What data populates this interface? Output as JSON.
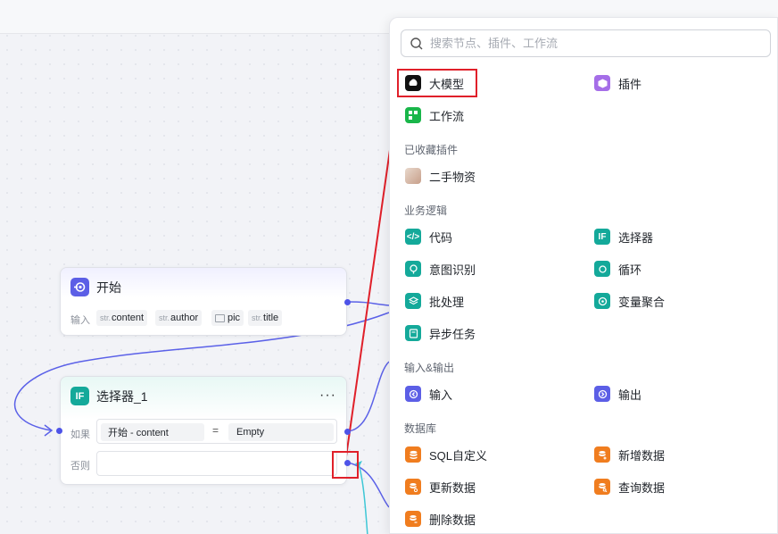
{
  "start_node": {
    "title": "开始",
    "input_label": "输入",
    "params": [
      {
        "type": "str.",
        "name": "content"
      },
      {
        "type": "str.",
        "name": "author"
      },
      {
        "type": "img",
        "name": "pic"
      },
      {
        "type": "str.",
        "name": "title"
      }
    ]
  },
  "selector_node": {
    "icon_text": "IF",
    "title": "选择器_1",
    "more": "···",
    "if_label": "如果",
    "else_label": "否则",
    "condition": {
      "left": "开始  -  content",
      "op": "=",
      "right": "Empty"
    }
  },
  "panel": {
    "search_placeholder": "搜索节点、插件、工作流",
    "top_items": [
      {
        "label": "大模型",
        "icon": "llm-icon"
      },
      {
        "label": "插件",
        "icon": "plugin-icon"
      },
      {
        "label": "工作流",
        "icon": "workflow-icon"
      }
    ],
    "sections": {
      "favorites": {
        "title": "已收藏插件",
        "items": [
          {
            "label": "二手物资",
            "icon": "avatar-icon"
          }
        ]
      },
      "logic": {
        "title": "业务逻辑",
        "items": [
          {
            "label": "代码",
            "icon": "code-icon"
          },
          {
            "label": "选择器",
            "icon": "if-icon",
            "icon_text": "IF"
          },
          {
            "label": "意图识别",
            "icon": "intent-icon"
          },
          {
            "label": "循环",
            "icon": "loop-icon"
          },
          {
            "label": "批处理",
            "icon": "batch-icon"
          },
          {
            "label": "变量聚合",
            "icon": "aggregate-icon"
          },
          {
            "label": "异步任务",
            "icon": "async-task-icon"
          }
        ]
      },
      "io": {
        "title": "输入&输出",
        "items": [
          {
            "label": "输入",
            "icon": "input-icon"
          },
          {
            "label": "输出",
            "icon": "output-icon"
          }
        ]
      },
      "database": {
        "title": "数据库",
        "items": [
          {
            "label": "SQL自定义",
            "icon": "database-icon"
          },
          {
            "label": "新增数据",
            "icon": "database-add-icon"
          },
          {
            "label": "更新数据",
            "icon": "database-update-icon"
          },
          {
            "label": "查询数据",
            "icon": "database-query-icon"
          },
          {
            "label": "删除数据",
            "icon": "database-delete-icon"
          }
        ]
      }
    }
  },
  "colors": {
    "accent": "#4d53e8",
    "highlight": "#e0202a",
    "logic": "#14a99a",
    "database": "#f07d1f",
    "io": "#5c5fe6"
  }
}
